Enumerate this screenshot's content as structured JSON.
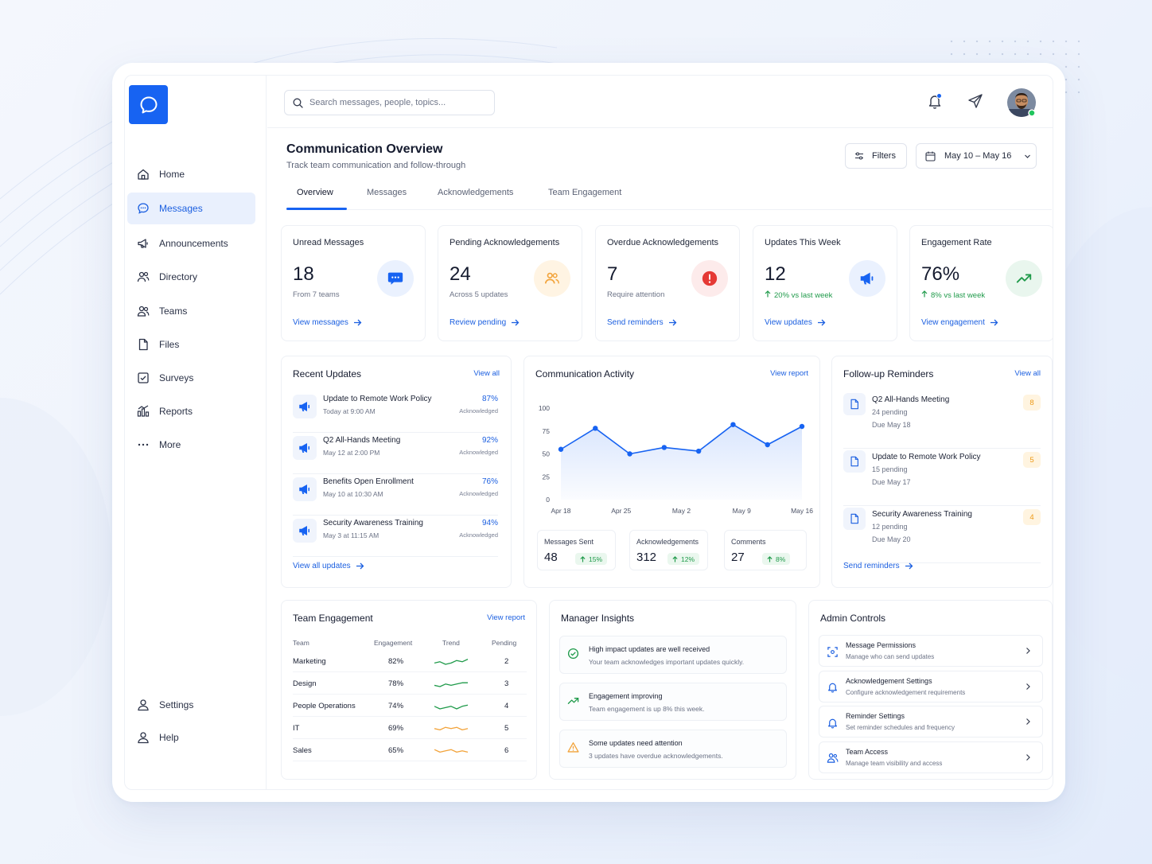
{
  "nav": {
    "items": [
      {
        "label": "Home",
        "icon": "home-icon"
      },
      {
        "label": "Messages",
        "icon": "message-icon",
        "active": true
      },
      {
        "label": "Announcements",
        "icon": "megaphone-icon"
      },
      {
        "label": "Directory",
        "icon": "directory-icon"
      },
      {
        "label": "Teams",
        "icon": "teams-icon"
      },
      {
        "label": "Files",
        "icon": "file-icon"
      },
      {
        "label": "Surveys",
        "icon": "checkbox-icon"
      },
      {
        "label": "Reports",
        "icon": "reports-icon"
      },
      {
        "label": "More",
        "icon": "more-icon"
      }
    ],
    "bottom": [
      {
        "label": "Settings",
        "icon": "settings-user-icon"
      },
      {
        "label": "Help",
        "icon": "help-user-icon"
      }
    ]
  },
  "search": {
    "placeholder": "Search messages, people, topics..."
  },
  "header": {
    "title": "Communication Overview",
    "subtitle": "Track team communication and follow-through",
    "filters_label": "Filters",
    "date_range": "May 10 – May 16"
  },
  "tabs": [
    {
      "label": "Overview",
      "active": true
    },
    {
      "label": "Messages"
    },
    {
      "label": "Acknowledgements"
    },
    {
      "label": "Team Engagement"
    }
  ],
  "kpis": [
    {
      "title": "Unread Messages",
      "value": "18",
      "sub": "From 7 teams",
      "link": "View messages",
      "icon": "chat-bubble-icon",
      "color": "#1763f2"
    },
    {
      "title": "Pending Acknowledgements",
      "value": "24",
      "sub": "Across 5 updates",
      "link": "Review pending",
      "icon": "people-icon",
      "color": "#f2a33a"
    },
    {
      "title": "Overdue Acknowledgements",
      "value": "7",
      "sub": "Require attention",
      "link": "Send reminders",
      "icon": "alert-icon",
      "color": "#e53935"
    },
    {
      "title": "Updates This Week",
      "value": "12",
      "sub": "20% vs last week",
      "link": "View updates",
      "icon": "megaphone-icon",
      "color": "#1763f2"
    },
    {
      "title": "Engagement Rate",
      "value": "76%",
      "sub": "8% vs last week",
      "link": "View engagement",
      "icon": "trend-up-icon",
      "color": "#1f9a4a"
    }
  ],
  "recent_updates": {
    "title": "Recent Updates",
    "view_all": "View all",
    "footer_link": "View all updates",
    "items": [
      {
        "title": "Update to Remote Work Policy",
        "time": "Today at 9:00 AM",
        "pct": "87%",
        "status": "Acknowledged"
      },
      {
        "title": "Q2 All-Hands Meeting",
        "time": "May 12 at 2:00 PM",
        "pct": "92%",
        "status": "Acknowledged"
      },
      {
        "title": "Benefits Open Enrollment",
        "time": "May 10 at 10:30 AM",
        "pct": "76%",
        "status": "Acknowledged"
      },
      {
        "title": "Security Awareness Training",
        "time": "May 3 at 11:15 AM",
        "pct": "94%",
        "status": "Acknowledged"
      }
    ]
  },
  "activity": {
    "title": "Communication Activity",
    "view_report": "View report",
    "stats": [
      {
        "label": "Messages Sent",
        "value": "48",
        "change": "15%"
      },
      {
        "label": "Acknowledgements",
        "value": "312",
        "change": "12%"
      },
      {
        "label": "Comments",
        "value": "27",
        "change": "8%"
      }
    ]
  },
  "chart_data": {
    "type": "area",
    "x_ticks": [
      "Apr 18",
      "Apr 25",
      "May 2",
      "May 9",
      "May 16"
    ],
    "y_ticks": [
      0,
      25,
      50,
      75,
      100
    ],
    "ylim": [
      0,
      100
    ],
    "series": [
      {
        "values": [
          55,
          78,
          50,
          57,
          53,
          82,
          60,
          80
        ]
      }
    ],
    "color": "#1763f2",
    "grid": false
  },
  "reminders": {
    "title": "Follow-up Reminders",
    "view_all": "View all",
    "footer_link": "Send reminders",
    "items": [
      {
        "title": "Q2 All-Hands Meeting",
        "pending": "24 pending",
        "due": "Due May 18",
        "count": "8"
      },
      {
        "title": "Update to Remote Work Policy",
        "pending": "15 pending",
        "due": "Due May 17",
        "count": "5"
      },
      {
        "title": "Security Awareness Training",
        "pending": "12 pending",
        "due": "Due May 20",
        "count": "4"
      }
    ]
  },
  "team_engagement": {
    "title": "Team Engagement",
    "view_report": "View report",
    "columns": [
      "Team",
      "Engagement",
      "Trend",
      "Pending"
    ],
    "rows": [
      {
        "team": "Marketing",
        "engagement": "82%",
        "pending": "2",
        "trend_color": "#1f9a4a"
      },
      {
        "team": "Design",
        "engagement": "78%",
        "pending": "3",
        "trend_color": "#1f9a4a"
      },
      {
        "team": "People Operations",
        "engagement": "74%",
        "pending": "4",
        "trend_color": "#1f9a4a"
      },
      {
        "team": "IT",
        "engagement": "69%",
        "pending": "5",
        "trend_color": "#f2a33a"
      },
      {
        "team": "Sales",
        "engagement": "65%",
        "pending": "6",
        "trend_color": "#f2a33a"
      }
    ]
  },
  "insights": {
    "title": "Manager Insights",
    "items": [
      {
        "title": "High impact updates are well received",
        "desc": "Your team acknowledges important updates quickly.",
        "icon": "check-circle-icon"
      },
      {
        "title": "Engagement improving",
        "desc": "Team engagement is up 8% this week.",
        "icon": "trend-up-icon"
      },
      {
        "title": "Some updates need attention",
        "desc": "3 updates have overdue acknowledgements.",
        "icon": "warning-icon"
      }
    ]
  },
  "admin": {
    "title": "Admin Controls",
    "items": [
      {
        "title": "Message Permissions",
        "desc": "Manage who can send updates",
        "icon": "permissions-icon"
      },
      {
        "title": "Acknowledgement Settings",
        "desc": "Configure acknowledgement requirements",
        "icon": "bell-icon"
      },
      {
        "title": "Reminder Settings",
        "desc": "Set reminder schedules and frequency",
        "icon": "bell-icon"
      },
      {
        "title": "Team Access",
        "desc": "Manage team visibility and access",
        "icon": "team-access-icon"
      }
    ]
  }
}
